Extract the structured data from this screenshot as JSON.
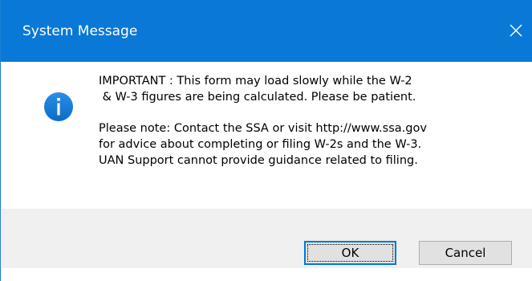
{
  "window": {
    "title": "System Message",
    "close_icon": "close-icon",
    "accent_color": "#0a78d7"
  },
  "message": {
    "icon": "info-icon",
    "lines_1": [
      "IMPORTANT : This form may load slowly while the W-2",
      " & W-3 figures are being calculated. Please be patient."
    ],
    "lines_2": [
      "Please note: Contact the SSA or visit http://www.ssa.gov",
      "for advice about completing or filing W-2s and the W-3.",
      "UAN Support cannot provide guidance related to filing."
    ]
  },
  "buttons": {
    "ok_label": "OK",
    "cancel_label": "Cancel"
  }
}
